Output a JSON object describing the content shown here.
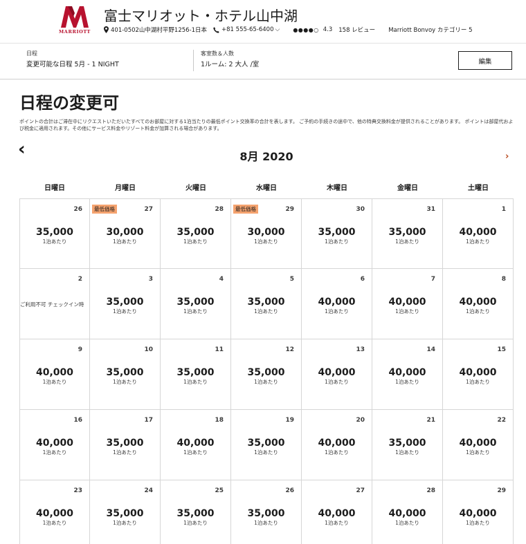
{
  "header": {
    "logo_text": "MARRIOTT",
    "hotel_name": "富士マリオット・ホテル山中湖",
    "address": "401-0502山中湖村平野1256-1日本",
    "phone": "+81 555-65-6400",
    "rating_dots": "●●●●○",
    "rating": "4.3",
    "reviews": "158 レビュー",
    "category": "Marriott Bonvoy カテゴリー 5"
  },
  "search_bar": {
    "dates_label": "日程",
    "dates_value": "変更可能な日程 5月 - 1 NIGHT",
    "guests_label": "客室数＆人数",
    "guests_value": "1ルーム: 2 大人 /室",
    "edit_label": "編集"
  },
  "page": {
    "title": "日程の変更可",
    "description": "ポイントの合計はご滞在中にリクエストいただいたすべてのお部屋に対する1泊当たりの最低ポイント交換率の合計を表します。 ご予約の手続きの途中で、他の特典交換料金が提供されることがあります。 ポイントは部屋代および税金に適用されます。その他にサービス料金やリゾート料金が加算される場合があります。"
  },
  "calendar": {
    "prev_icon": "‹",
    "next_icon": "›",
    "month_label": "8月 2020",
    "weekdays": [
      "日曜日",
      "月曜日",
      "火曜日",
      "水曜日",
      "木曜日",
      "金曜日",
      "土曜日"
    ],
    "per_night": "1泊あたり",
    "lowest_badge": "最低価格",
    "weeks": [
      [
        {
          "day": "26",
          "price": "35,000"
        },
        {
          "day": "27",
          "price": "30,000",
          "lowest": true
        },
        {
          "day": "28",
          "price": "35,000"
        },
        {
          "day": "29",
          "price": "30,000",
          "lowest": true
        },
        {
          "day": "30",
          "price": "35,000"
        },
        {
          "day": "31",
          "price": "35,000"
        },
        {
          "day": "1",
          "price": "40,000"
        }
      ],
      [
        {
          "day": "2",
          "unavailable": "ご利用不可 チェックイン時"
        },
        {
          "day": "3",
          "price": "35,000"
        },
        {
          "day": "4",
          "price": "35,000"
        },
        {
          "day": "5",
          "price": "35,000"
        },
        {
          "day": "6",
          "price": "40,000"
        },
        {
          "day": "7",
          "price": "40,000"
        },
        {
          "day": "8",
          "price": "40,000"
        }
      ],
      [
        {
          "day": "9",
          "price": "40,000"
        },
        {
          "day": "10",
          "price": "35,000"
        },
        {
          "day": "11",
          "price": "35,000"
        },
        {
          "day": "12",
          "price": "35,000"
        },
        {
          "day": "13",
          "price": "40,000"
        },
        {
          "day": "14",
          "price": "40,000"
        },
        {
          "day": "15",
          "price": "40,000"
        }
      ],
      [
        {
          "day": "16",
          "price": "40,000"
        },
        {
          "day": "17",
          "price": "35,000"
        },
        {
          "day": "18",
          "price": "40,000"
        },
        {
          "day": "19",
          "price": "35,000"
        },
        {
          "day": "20",
          "price": "40,000"
        },
        {
          "day": "21",
          "price": "35,000"
        },
        {
          "day": "22",
          "price": "40,000"
        }
      ],
      [
        {
          "day": "23",
          "price": "40,000"
        },
        {
          "day": "24",
          "price": "35,000"
        },
        {
          "day": "25",
          "price": "35,000"
        },
        {
          "day": "26",
          "price": "35,000"
        },
        {
          "day": "27",
          "price": "40,000"
        },
        {
          "day": "28",
          "price": "40,000"
        },
        {
          "day": "29",
          "price": "40,000"
        }
      ]
    ]
  },
  "colors": {
    "brand_red": "#b8122f",
    "badge_orange": "#f5a36f",
    "next_arrow": "#b84a1f"
  }
}
